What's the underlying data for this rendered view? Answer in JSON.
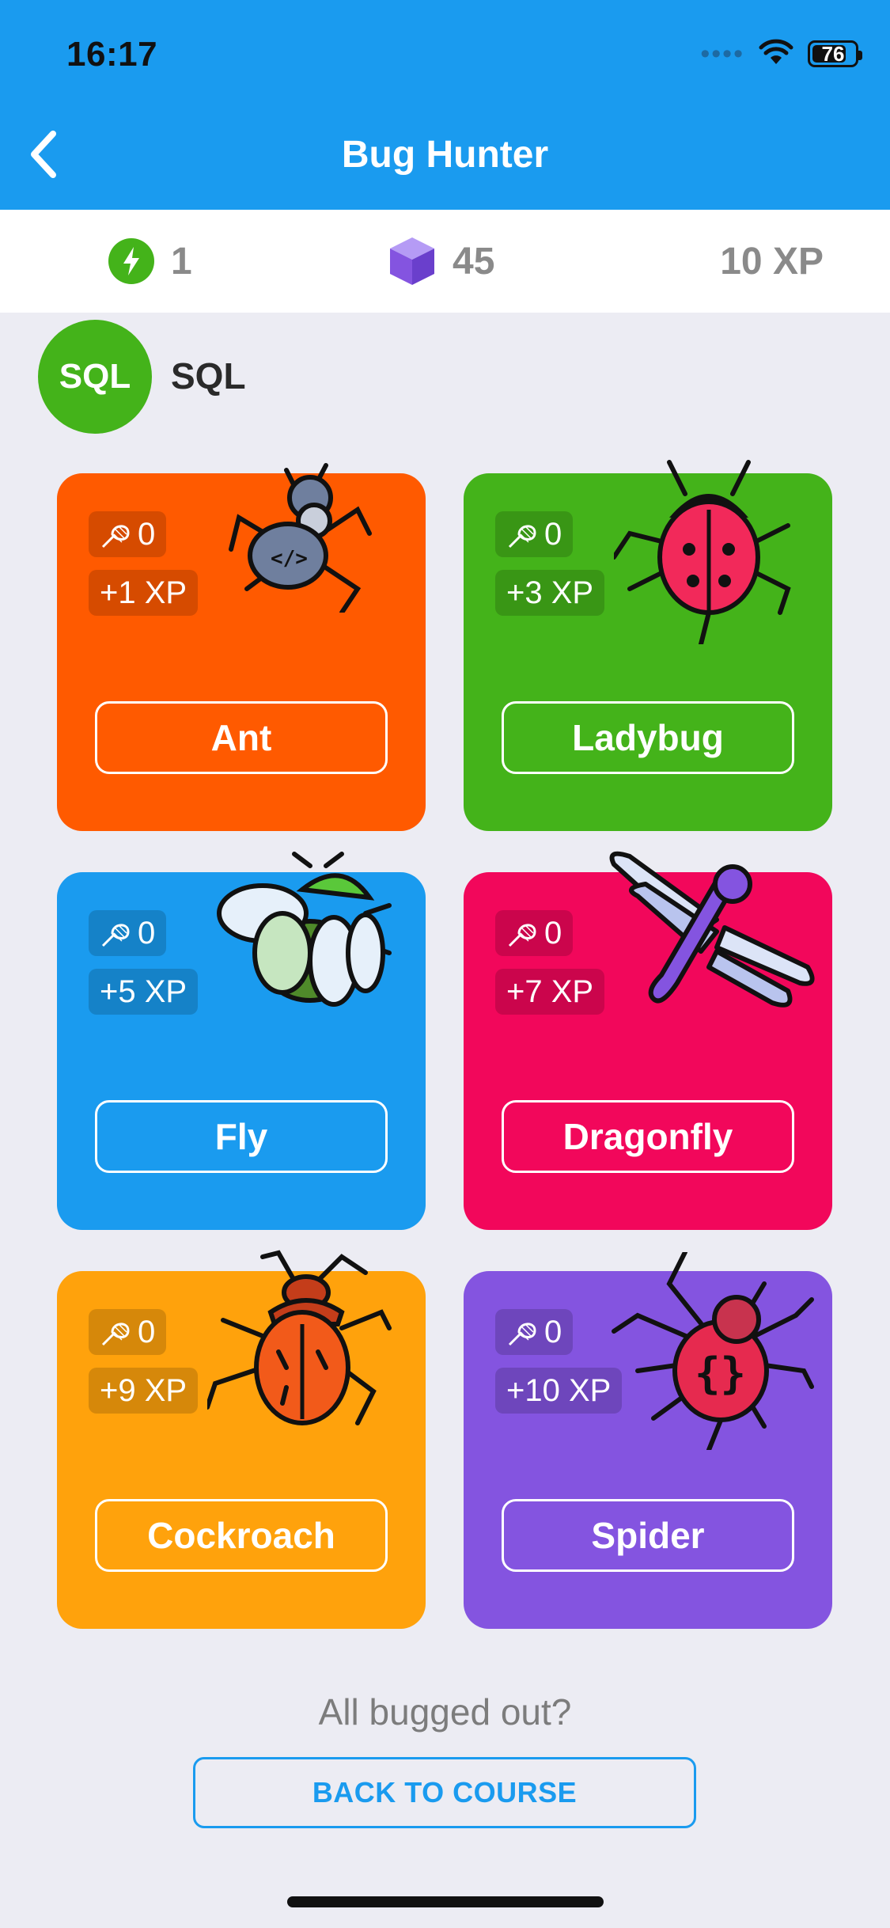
{
  "status_bar": {
    "time": "16:17",
    "battery": "76",
    "battery_level": 0.76
  },
  "header": {
    "title": "Bug Hunter",
    "back_icon": "chevron-left-icon"
  },
  "stats": {
    "energy": "1",
    "gems": "45",
    "xp": "10 XP"
  },
  "course": {
    "avatar_text": "SQL",
    "name": "SQL"
  },
  "bugs": [
    {
      "name": "Ant",
      "count": "0",
      "xp": "+1 XP",
      "color": "#FF5A00",
      "icon": "ant-icon"
    },
    {
      "name": "Ladybug",
      "count": "0",
      "xp": "+3 XP",
      "color": "#44B31A",
      "icon": "ladybug-icon"
    },
    {
      "name": "Fly",
      "count": "0",
      "xp": "+5 XP",
      "color": "#1A9BEF",
      "icon": "fly-icon"
    },
    {
      "name": "Dragonfly",
      "count": "0",
      "xp": "+7 XP",
      "color": "#F2075B",
      "icon": "dragonfly-icon"
    },
    {
      "name": "Cockroach",
      "count": "0",
      "xp": "+9 XP",
      "color": "#FFA20C",
      "icon": "cockroach-icon"
    },
    {
      "name": "Spider",
      "count": "0",
      "xp": "+10 XP",
      "color": "#8454E0",
      "icon": "spider-icon"
    }
  ],
  "footer": {
    "prompt": "All bugged out?",
    "button": "BACK TO COURSE"
  },
  "colors": {
    "primary": "#1A9BEF",
    "background": "#ECECF3"
  }
}
